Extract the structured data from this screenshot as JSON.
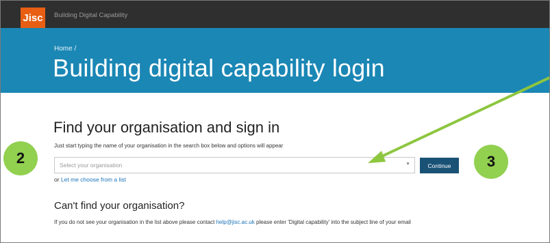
{
  "header": {
    "logo_text": "Jisc",
    "site_title": "Building Digital Capability"
  },
  "hero": {
    "breadcrumb": "Home /",
    "title": "Building digital capability login"
  },
  "main": {
    "find_title": "Find your organisation and sign in",
    "hint": "Just start typing the name of your organisation in the search box below and options will appear",
    "select_placeholder": "Select your organisation",
    "continue_label": "Continue",
    "or_text": "or",
    "choose_link": "Let me choose from a list",
    "cant_find_title": "Can't find your organisation?",
    "contact_before": "If you do not see your organisation in the list above please contact",
    "contact_email": "help@jisc.ac.uk",
    "contact_after": "please enter 'Digital capability' into the subject line of your email"
  },
  "annotations": {
    "badge_2": "2",
    "badge_3": "3",
    "badge_color": "#92d050",
    "arrow_color": "#8dc63f"
  },
  "colors": {
    "topbar": "#2f2f2f",
    "logo": "#e85e13",
    "hero": "#1b87b5",
    "button": "#1a5276",
    "link": "#1a73b8"
  }
}
